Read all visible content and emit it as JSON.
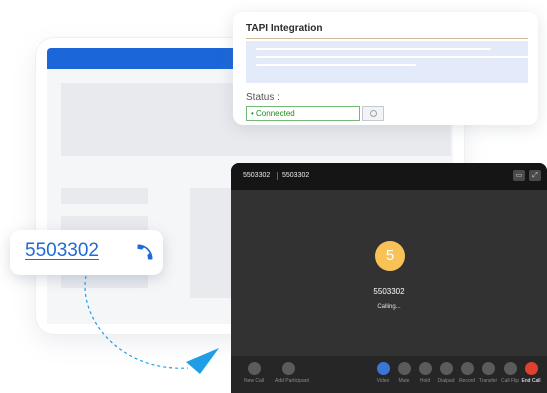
{
  "tapi_panel": {
    "title": "TAPI Integration",
    "status_label": "Status :",
    "status_value": "Connected"
  },
  "call_window": {
    "header_left": "5503302",
    "header_right": "5503302",
    "avatar_letter": "5",
    "callee_number": "5503302",
    "call_state": "Calling...",
    "toolbar": {
      "new_call": "New Call",
      "add_participant": "Add Participant",
      "video": "Video",
      "mute": "Mute",
      "hold": "Hold",
      "dialpad": "Dialpad",
      "record": "Record",
      "transfer": "Transfer",
      "call_flip": "Call Flip",
      "end_call": "End Call"
    }
  },
  "phone_link": {
    "number": "5503302",
    "icon": "phone-icon"
  },
  "colors": {
    "brand_blue": "#1b66d9",
    "connected_green": "#1f8a1f",
    "avatar_yellow": "#f8c257",
    "end_call_red": "#e0402e",
    "arrow_cyan": "#1f9ee6"
  }
}
